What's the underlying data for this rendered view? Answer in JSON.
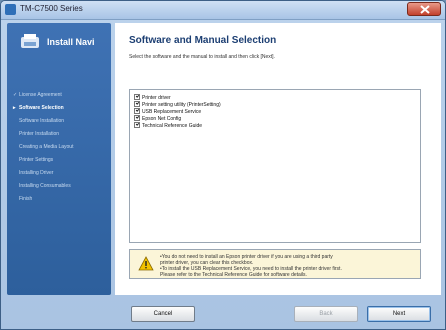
{
  "window": {
    "title": "TM-C7500 Series"
  },
  "sidebar": {
    "brand": "Install Navi",
    "steps": [
      {
        "label": "License Agreement",
        "state": "done"
      },
      {
        "label": "Software Selection",
        "state": "current"
      },
      {
        "label": "Software Installation",
        "state": "todo"
      },
      {
        "label": "Printer Installation",
        "state": "todo"
      },
      {
        "label": "Creating a Media Layout",
        "state": "todo"
      },
      {
        "label": "Printer Settings",
        "state": "todo"
      },
      {
        "label": "Installing Driver",
        "state": "todo"
      },
      {
        "label": "Installing Consumables",
        "state": "todo"
      },
      {
        "label": "Finish",
        "state": "todo"
      }
    ]
  },
  "main": {
    "title": "Software and Manual Selection",
    "subtitle": "Select the software and the manual to install and then click [Next].",
    "items": [
      {
        "label": "Printer driver",
        "checked": true
      },
      {
        "label": "Printer setting utility (PrinterSetting)",
        "checked": true
      },
      {
        "label": "USB Replacement Service",
        "checked": true
      },
      {
        "label": "Epson Net Config",
        "checked": true
      },
      {
        "label": "Technical Reference Guide",
        "checked": true
      }
    ],
    "notice_lines": [
      "•You do not need to install an Epson printer driver if you are using a third party",
      " printer driver, you can clear this checkbox.",
      "•To install the USB Replacement Service, you need to install the printer driver first.",
      " Please refer to the Technical Reference Guide for software details."
    ]
  },
  "buttons": {
    "cancel": "Cancel",
    "back": "Back",
    "next": "Next"
  },
  "colors": {
    "sidebar": "#3a6aab",
    "title": "#1d3f73",
    "notice_bg": "#fbf5d8"
  }
}
